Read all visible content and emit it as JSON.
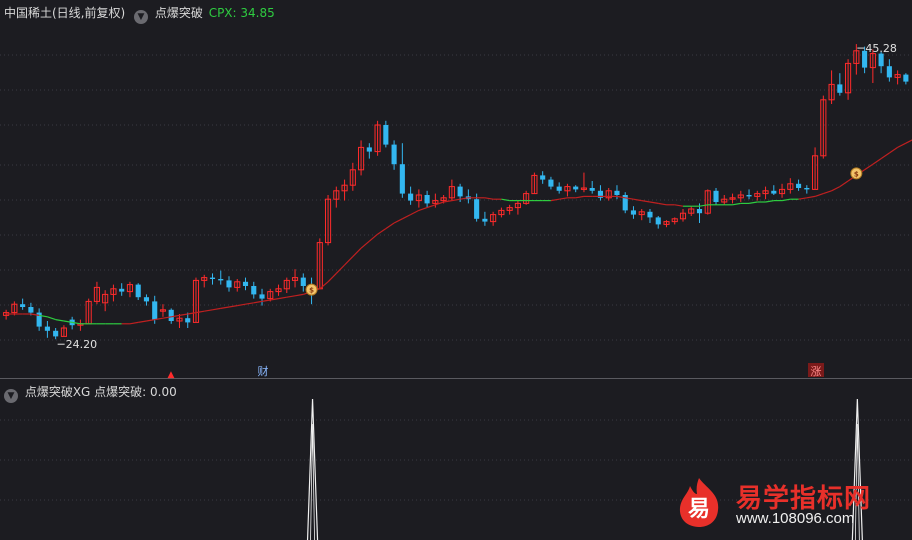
{
  "header": {
    "instrument": "中国稀土(日线,前复权)",
    "indicator": "点爆突破",
    "cpx_label": "CPX: 34.85",
    "toggle_icon": "chevron-down-circle-icon"
  },
  "sub_header": {
    "label": "点爆突破XG  点爆突破: 0.00",
    "toggle_icon": "chevron-down-circle-icon"
  },
  "markers": {
    "low_price": "24.20",
    "high_price": "45.28",
    "signal_cai": "财",
    "signal_zhang": "涨",
    "signal_up": "▲"
  },
  "watermark": {
    "badge_char": "易",
    "site_name": "易学指标网",
    "site_url": "www.108096.com"
  },
  "colors": {
    "up": "#ff2b2b",
    "down": "#33b7f0",
    "ma_red": "#c02020",
    "ma_green": "#2ecc40",
    "background": "#1c1c21"
  },
  "chart_data": {
    "type": "candlestick",
    "price_range": [
      22,
      47
    ],
    "candles": [
      [
        25.9,
        26.3,
        25.6,
        26.1
      ],
      [
        26.1,
        26.9,
        25.9,
        26.7
      ],
      [
        26.7,
        27.1,
        26.3,
        26.5
      ],
      [
        26.5,
        26.8,
        25.9,
        26.1
      ],
      [
        26.1,
        26.4,
        24.8,
        25.1
      ],
      [
        25.1,
        25.5,
        24.3,
        24.8
      ],
      [
        24.8,
        25.0,
        24.2,
        24.4
      ],
      [
        24.4,
        25.2,
        24.4,
        25.0
      ],
      [
        25.6,
        25.8,
        24.9,
        25.2
      ],
      [
        25.2,
        25.6,
        24.8,
        25.3
      ],
      [
        25.3,
        27.1,
        25.3,
        26.9
      ],
      [
        26.9,
        28.3,
        26.7,
        27.9
      ],
      [
        26.8,
        27.7,
        26.2,
        27.4
      ],
      [
        27.4,
        28.1,
        26.9,
        27.8
      ],
      [
        27.8,
        28.2,
        27.3,
        27.6
      ],
      [
        27.6,
        28.3,
        27.2,
        28.1
      ],
      [
        28.1,
        28.2,
        27.0,
        27.2
      ],
      [
        27.2,
        27.4,
        26.6,
        26.9
      ],
      [
        26.9,
        27.3,
        25.3,
        25.6
      ],
      [
        26.2,
        26.7,
        25.8,
        26.3
      ],
      [
        26.3,
        26.4,
        25.3,
        25.5
      ],
      [
        25.5,
        26.0,
        25.0,
        25.7
      ],
      [
        25.7,
        26.1,
        25.0,
        25.4
      ],
      [
        25.4,
        28.6,
        25.4,
        28.4
      ],
      [
        28.4,
        28.8,
        27.9,
        28.6
      ],
      [
        28.6,
        28.9,
        28.1,
        28.5
      ],
      [
        28.5,
        29.1,
        28.1,
        28.4
      ],
      [
        28.4,
        28.7,
        27.6,
        27.9
      ],
      [
        27.9,
        28.5,
        27.6,
        28.3
      ],
      [
        28.3,
        28.6,
        27.7,
        28.0
      ],
      [
        28.0,
        28.3,
        27.1,
        27.4
      ],
      [
        27.4,
        27.8,
        26.6,
        27.1
      ],
      [
        27.1,
        27.8,
        26.9,
        27.6
      ],
      [
        27.6,
        28.1,
        27.3,
        27.8
      ],
      [
        27.8,
        28.6,
        27.5,
        28.4
      ],
      [
        28.4,
        29.2,
        27.9,
        28.6
      ],
      [
        28.6,
        28.9,
        27.6,
        28.0
      ],
      [
        28.0,
        28.6,
        26.7,
        27.8
      ],
      [
        27.8,
        31.4,
        27.8,
        31.1
      ],
      [
        31.1,
        34.5,
        30.9,
        34.2
      ],
      [
        34.2,
        35.1,
        33.6,
        34.8
      ],
      [
        34.8,
        35.6,
        34.1,
        35.2
      ],
      [
        35.2,
        36.8,
        34.8,
        36.3
      ],
      [
        36.3,
        38.4,
        35.9,
        37.9
      ],
      [
        37.9,
        38.2,
        37.1,
        37.6
      ],
      [
        37.6,
        39.8,
        37.3,
        39.5
      ],
      [
        39.5,
        39.8,
        37.9,
        38.1
      ],
      [
        38.1,
        38.4,
        36.3,
        36.7
      ],
      [
        36.7,
        38.2,
        34.3,
        34.6
      ],
      [
        34.6,
        35.1,
        33.8,
        34.1
      ],
      [
        34.1,
        34.9,
        33.6,
        34.5
      ],
      [
        34.5,
        34.8,
        33.6,
        33.9
      ],
      [
        33.9,
        34.6,
        33.6,
        34.1
      ],
      [
        34.1,
        34.5,
        33.9,
        34.3
      ],
      [
        34.3,
        35.6,
        34.1,
        35.1
      ],
      [
        35.1,
        35.3,
        34.0,
        34.4
      ],
      [
        34.4,
        34.9,
        33.9,
        34.2
      ],
      [
        34.2,
        34.6,
        32.6,
        32.8
      ],
      [
        32.8,
        33.3,
        32.3,
        32.6
      ],
      [
        32.6,
        33.3,
        32.3,
        33.1
      ],
      [
        33.1,
        33.6,
        32.9,
        33.4
      ],
      [
        33.4,
        33.8,
        33.1,
        33.6
      ],
      [
        33.6,
        34.1,
        33.1,
        33.9
      ],
      [
        33.9,
        34.8,
        33.8,
        34.6
      ],
      [
        34.6,
        36.1,
        34.6,
        35.9
      ],
      [
        35.9,
        36.2,
        35.3,
        35.6
      ],
      [
        35.6,
        35.8,
        34.9,
        35.1
      ],
      [
        35.1,
        35.4,
        34.6,
        34.8
      ],
      [
        34.8,
        35.3,
        34.4,
        35.1
      ],
      [
        35.1,
        35.2,
        34.7,
        34.9
      ],
      [
        34.9,
        36.1,
        34.7,
        35.0
      ],
      [
        35.0,
        35.5,
        34.6,
        34.8
      ],
      [
        34.8,
        35.2,
        34.1,
        34.3
      ],
      [
        34.3,
        35.0,
        34.1,
        34.8
      ],
      [
        34.8,
        35.2,
        34.2,
        34.5
      ],
      [
        34.5,
        34.7,
        33.2,
        33.4
      ],
      [
        33.4,
        33.7,
        32.8,
        33.1
      ],
      [
        33.1,
        33.5,
        32.7,
        33.3
      ],
      [
        33.3,
        33.5,
        32.5,
        32.9
      ],
      [
        32.9,
        33.0,
        32.1,
        32.4
      ],
      [
        32.4,
        32.7,
        32.2,
        32.6
      ],
      [
        32.6,
        32.9,
        32.4,
        32.8
      ],
      [
        32.8,
        33.5,
        32.6,
        33.2
      ],
      [
        33.2,
        33.7,
        33.0,
        33.5
      ],
      [
        33.5,
        33.9,
        32.5,
        33.2
      ],
      [
        33.2,
        34.9,
        33.1,
        34.8
      ],
      [
        34.8,
        35.0,
        33.8,
        34.0
      ],
      [
        34.0,
        34.5,
        33.8,
        34.2
      ],
      [
        34.2,
        34.6,
        33.9,
        34.3
      ],
      [
        34.3,
        34.8,
        34.0,
        34.5
      ],
      [
        34.5,
        34.9,
        34.2,
        34.4
      ],
      [
        34.4,
        34.8,
        34.1,
        34.6
      ],
      [
        34.6,
        35.1,
        34.2,
        34.8
      ],
      [
        34.8,
        35.2,
        34.5,
        34.6
      ],
      [
        34.6,
        35.3,
        34.3,
        34.9
      ],
      [
        34.9,
        35.7,
        34.6,
        35.3
      ],
      [
        35.3,
        35.6,
        34.8,
        35.0
      ],
      [
        35.0,
        35.2,
        34.6,
        34.9
      ],
      [
        34.9,
        37.9,
        34.9,
        37.3
      ],
      [
        37.3,
        41.6,
        37.1,
        41.3
      ],
      [
        41.3,
        43.4,
        41.0,
        42.4
      ],
      [
        42.4,
        43.2,
        41.6,
        41.8
      ],
      [
        41.8,
        44.2,
        41.3,
        43.9
      ],
      [
        43.9,
        45.28,
        43.1,
        44.8
      ],
      [
        44.8,
        45.1,
        43.2,
        43.6
      ],
      [
        43.6,
        44.9,
        42.5,
        44.6
      ],
      [
        44.6,
        44.8,
        43.2,
        43.7
      ],
      [
        43.7,
        44.2,
        42.6,
        42.9
      ],
      [
        42.9,
        43.4,
        42.4,
        43.1
      ],
      [
        43.1,
        43.2,
        42.4,
        42.6
      ]
    ],
    "ma": [
      26.0,
      26.0,
      26.0,
      26.0,
      25.9,
      25.8,
      25.6,
      25.5,
      25.4,
      25.3,
      25.3,
      25.3,
      25.3,
      25.3,
      25.3,
      25.3,
      25.4,
      25.5,
      25.6,
      25.7,
      25.8,
      25.9,
      26.0,
      26.1,
      26.2,
      26.3,
      26.4,
      26.5,
      26.6,
      26.7,
      26.8,
      26.9,
      27.0,
      27.1,
      27.2,
      27.3,
      27.4,
      27.6,
      27.8,
      28.3,
      28.9,
      29.5,
      30.1,
      30.7,
      31.2,
      31.7,
      32.1,
      32.5,
      32.8,
      33.1,
      33.4,
      33.6,
      33.8,
      34.0,
      34.1,
      34.2,
      34.3,
      34.3,
      34.3,
      34.2,
      34.2,
      34.1,
      34.1,
      34.1,
      34.1,
      34.1,
      34.1,
      34.2,
      34.3,
      34.3,
      34.4,
      34.4,
      34.4,
      34.4,
      34.4,
      34.3,
      34.2,
      34.1,
      34.0,
      33.9,
      33.8,
      33.8,
      33.7,
      33.7,
      33.7,
      33.8,
      33.8,
      33.8,
      33.8,
      33.9,
      33.9,
      34.0,
      34.0,
      34.1,
      34.1,
      34.2,
      34.2,
      34.3,
      34.4,
      34.6,
      34.8,
      35.1,
      35.5,
      35.9,
      36.3,
      36.7,
      37.1,
      37.5,
      37.9,
      38.2,
      38.5,
      38.8
    ],
    "ma_green_ranges": [
      [
        4,
        14
      ],
      [
        60,
        66
      ],
      [
        82,
        96
      ]
    ],
    "signal_markers": [
      {
        "index": 37,
        "type": "breakout-coin"
      },
      {
        "index": 103,
        "type": "breakout-coin"
      }
    ],
    "sub_signal": {
      "series": "点爆突破",
      "value": 0.0,
      "spikes": [
        37,
        103
      ],
      "spike_value": 1
    }
  }
}
